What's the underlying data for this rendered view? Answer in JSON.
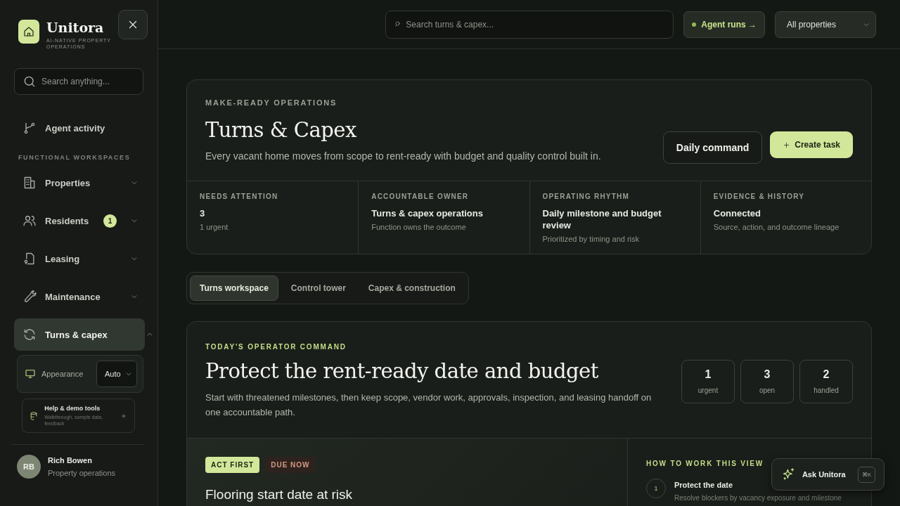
{
  "brand": {
    "name": "Unitora",
    "tagline": "AI-NATIVE PROPERTY OPERATIONS"
  },
  "sidebar": {
    "search": {
      "placeholder": "Search anything..."
    },
    "top_items": [
      {
        "label": "Agent activity",
        "selected": false
      }
    ],
    "section_label": "FUNCTIONAL WORKSPACES",
    "items": [
      {
        "label": "Properties",
        "selected": false,
        "expanded": false
      },
      {
        "label": "Residents",
        "selected": false,
        "expanded": false,
        "badge": "1"
      },
      {
        "label": "Leasing",
        "selected": false,
        "expanded": false
      },
      {
        "label": "Maintenance",
        "selected": false,
        "expanded": false
      },
      {
        "label": "Turns & capex",
        "selected": true,
        "expanded": true
      }
    ],
    "appearance": {
      "label": "Appearance",
      "value": "Auto"
    },
    "help": {
      "title": "Help & demo tools",
      "subtitle": "Walkthrough, sample data, feedback"
    },
    "user": {
      "initials": "RB",
      "name": "Rich Bowen",
      "role": "Property operations"
    }
  },
  "topbar": {
    "search": {
      "placeholder": "Search turns & capex..."
    },
    "agent_button": "Agent runs →",
    "property_select": "All properties"
  },
  "header": {
    "eyebrow": "MAKE-READY OPERATIONS",
    "title": "Turns & Capex",
    "description": "Every vacant home moves from scope to rent-ready with budget and quality control built in.",
    "buttons": [
      {
        "label": "Daily command",
        "kind": "secondary"
      },
      {
        "label": "Create task",
        "kind": "primary"
      }
    ],
    "stats": [
      {
        "label": "NEEDS ATTENTION",
        "value": "3",
        "note": "1 urgent"
      },
      {
        "label": "ACCOUNTABLE OWNER",
        "value": "Turns & capex operations",
        "note": "Function owns the outcome"
      },
      {
        "label": "OPERATING RHYTHM",
        "value": "Daily milestone and budget review",
        "note": "Prioritized by timing and risk"
      },
      {
        "label": "EVIDENCE & HISTORY",
        "value": "Connected",
        "note": "Source, action, and outcome lineage"
      }
    ]
  },
  "tabs": [
    {
      "label": "Turns workspace",
      "selected": true
    },
    {
      "label": "Control tower",
      "selected": false
    },
    {
      "label": "Capex & construction",
      "selected": false
    }
  ],
  "command": {
    "eyebrow": "TODAY'S OPERATOR COMMAND",
    "title": "Protect the rent-ready date and budget",
    "description": "Start with threatened milestones, then keep scope, vendor work, approvals, inspection, and leasing handoff on one accountable path.",
    "counters": [
      {
        "value": "1",
        "label": "urgent"
      },
      {
        "value": "3",
        "label": "open"
      },
      {
        "value": "2",
        "label": "handled"
      }
    ],
    "task": {
      "tags": [
        {
          "label": "ACT FIRST",
          "kind": "accent"
        },
        {
          "label": "DUE NOW",
          "kind": "warning"
        }
      ],
      "title": "Flooring start date at risk"
    },
    "guide": {
      "eyebrow": "HOW TO WORK THIS VIEW",
      "steps": [
        {
          "number": "1",
          "title": "Protect the date",
          "text": "Resolve blockers by vacancy exposure and milestone"
        }
      ]
    }
  },
  "assistant": {
    "label": "Ask Unitora",
    "shortcut": "⌘K"
  }
}
